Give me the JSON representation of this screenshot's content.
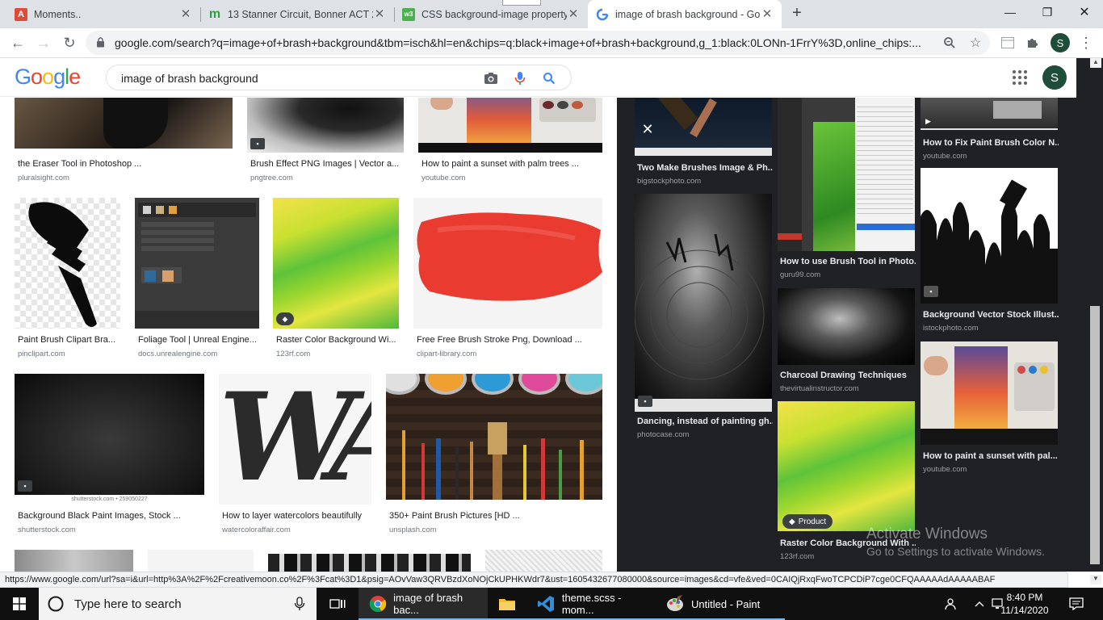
{
  "tabs": [
    {
      "title": "Moments..",
      "favicon": "A",
      "color": "#dd4b39"
    },
    {
      "title": "13 Stanner Circuit, Bonner ACT 26",
      "favicon": "m",
      "color": "#2aa13f"
    },
    {
      "title": "CSS background-image property",
      "favicon": "w3",
      "color": "#4caf50"
    },
    {
      "title": "image of brash background - Go",
      "favicon": "G",
      "color": "#4285f4"
    }
  ],
  "toolbar": {
    "url": "google.com/search?q=image+of+brash+background&tbm=isch&hl=en&chips=q:black+image+of+brash+background,g_1:black:0LONn-1FrrY%3D,online_chips:...",
    "profile_initial": "S"
  },
  "google": {
    "logo_letters": [
      "G",
      "o",
      "o",
      "g",
      "l",
      "e"
    ],
    "logo_colors": [
      "#4285f4",
      "#ea4335",
      "#fbbc05",
      "#4285f4",
      "#34a853",
      "#ea4335"
    ],
    "query": "image of brash background",
    "avatar_initial": "S"
  },
  "results": [
    {
      "title": "the Eraser Tool in Photoshop ...",
      "source": "pluralsight.com"
    },
    {
      "title": "Brush Effect PNG Images | Vector a...",
      "source": "pngtree.com"
    },
    {
      "title": "How to paint a sunset with palm trees ...",
      "source": "youtube.com"
    },
    {
      "title": "Paint Brush Clipart Bra...",
      "source": "pinclipart.com"
    },
    {
      "title": "Foliage Tool | Unreal Engine...",
      "source": "docs.unrealengine.com"
    },
    {
      "title": "Raster Color Background Wi...",
      "source": "123rf.com"
    },
    {
      "title": "Free Free Brush Stroke Png, Download ...",
      "source": "clipart-library.com"
    },
    {
      "title": "Background Black Paint Images, Stock ...",
      "source": "shutterstock.com",
      "watermark": "shutterstock.com • 259050227"
    },
    {
      "title": "How to layer watercolors beautifully",
      "source": "watercoloraffair.com",
      "letters": "WA"
    },
    {
      "title": "350+ Paint Brush Pictures [HD ...",
      "source": "unsplash.com"
    }
  ],
  "panel": [
    {
      "title": "Two Make Brushes Image & Ph...",
      "source": "bigstockphoto.com"
    },
    {
      "title": "How to use Brush Tool in Photo...",
      "source": "guru99.com"
    },
    {
      "title": "How to Fix Paint Brush Color N...",
      "source": "youtube.com"
    },
    {
      "title": "Background Vector Stock Illust...",
      "source": "istockphoto.com"
    },
    {
      "title": "Dancing, instead of painting gh...",
      "source": "photocase.com"
    },
    {
      "title": "Charcoal Drawing Techniques",
      "source": "thevirtualinstructor.com"
    },
    {
      "title": "How to paint a sunset with pal...",
      "source": "youtube.com"
    },
    {
      "title": "Raster Color Background With ...",
      "source": "123rf.com"
    }
  ],
  "product_chip": "Product",
  "activate": {
    "line1": "Activate Windows",
    "line2": "Go to Settings to activate Windows."
  },
  "status_url": "https://www.google.com/url?sa=i&url=http%3A%2F%2Fcreativemoon.co%2F%3Fcat%3D1&psig=AOvVaw3QRVBzdXoNOjCkUPHKWdr7&ust=1605432677080000&source=images&cd=vfe&ved=0CAIQjRxqFwoTCPCDiP7cge0CFQAAAAAdAAAAABAF",
  "taskbar": {
    "search_placeholder": "Type here to search",
    "apps": [
      {
        "label": "image of brash bac..."
      },
      {
        "label": ""
      },
      {
        "label": "theme.scss - mom..."
      },
      {
        "label": "Untitled - Paint"
      }
    ],
    "time": "8:40 PM",
    "date": "11/14/2020"
  }
}
